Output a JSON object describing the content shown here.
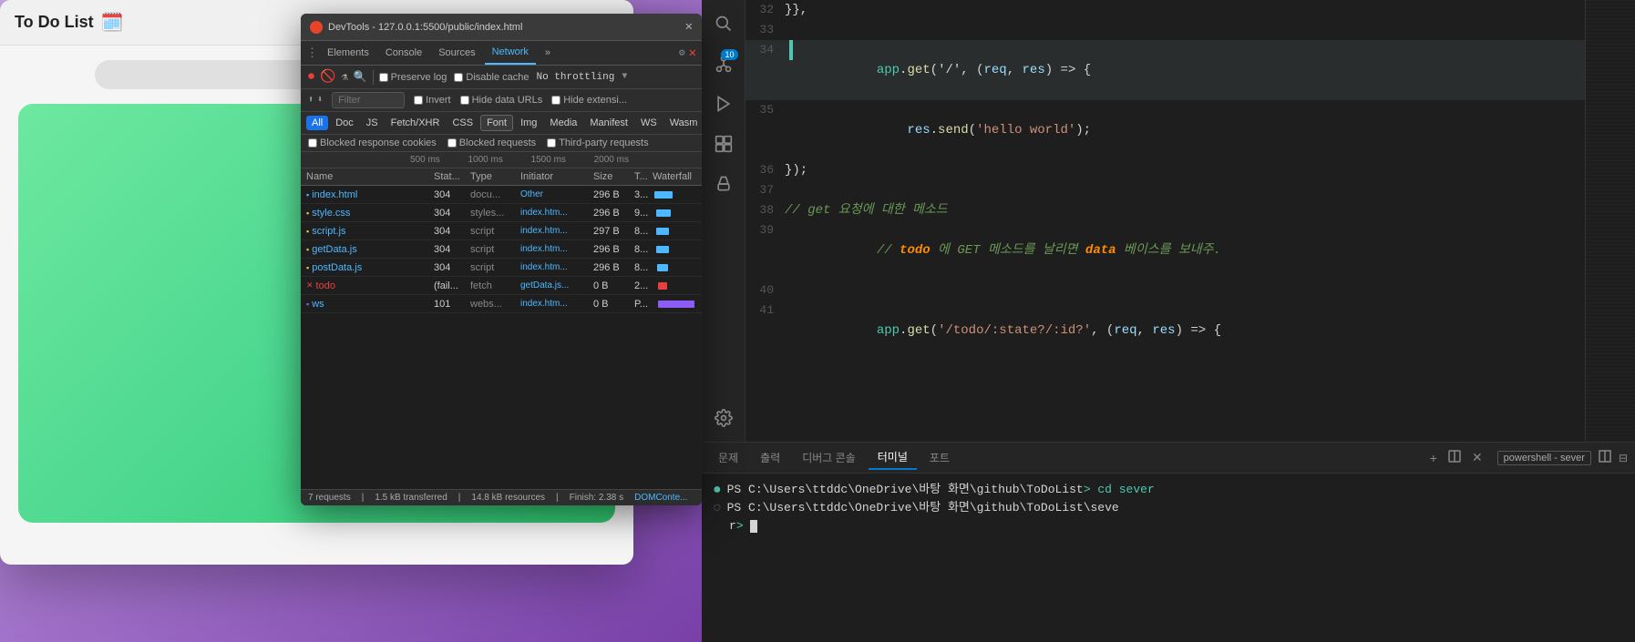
{
  "todo_app": {
    "title": "To Do List",
    "icon": "🗓️"
  },
  "devtools": {
    "title": "DevTools - 127.0.0.1:5500/public/index.html",
    "tabs": [
      "Elements",
      "Console",
      "Sources",
      "Network",
      "»"
    ],
    "active_tab": "Network",
    "toolbar": {
      "preserve_log": "Preserve log",
      "disable_cache": "Disable cache",
      "throttle": "No throttling"
    },
    "filter_placeholder": "Filter",
    "filter_options": [
      "Invert",
      "Hide data URLs",
      "Hide extensi..."
    ],
    "type_buttons": [
      "All",
      "Doc",
      "JS",
      "Fetch/XHR",
      "CSS",
      "Font",
      "Img",
      "Media",
      "Manifest",
      "WS",
      "Wasm"
    ],
    "active_type": "All",
    "highlighted_type": "Font",
    "blocked_options": [
      "Blocked response cookies",
      "Blocked requests",
      "Third-party requests"
    ],
    "timeline_labels": [
      "500 ms",
      "1000 ms",
      "1500 ms",
      "2000 ms"
    ],
    "table_headers": [
      "Name",
      "Stat...",
      "Type",
      "Initiator",
      "Size",
      "T...",
      "Waterfall"
    ],
    "requests": [
      {
        "name": "index.html",
        "status": "304",
        "type": "docu...",
        "initiator": "Other",
        "size": "296 B",
        "time": "3...",
        "icon": "doc"
      },
      {
        "name": "style.css",
        "status": "304",
        "type": "styles...",
        "initiator": "index.htm...",
        "size": "296 B",
        "time": "9...",
        "icon": "css"
      },
      {
        "name": "script.js",
        "status": "304",
        "type": "script",
        "initiator": "index.htm...",
        "size": "297 B",
        "time": "8...",
        "icon": "js"
      },
      {
        "name": "getData.js",
        "status": "304",
        "type": "script",
        "initiator": "index.htm...",
        "size": "296 B",
        "time": "8...",
        "icon": "js"
      },
      {
        "name": "postData.js",
        "status": "304",
        "type": "script",
        "initiator": "index.htm...",
        "size": "296 B",
        "time": "8...",
        "icon": "js"
      },
      {
        "name": "todo",
        "status": "(fail...",
        "type": "fetch",
        "initiator": "getData.js...",
        "size": "0 B",
        "time": "2...",
        "icon": "error"
      },
      {
        "name": "ws",
        "status": "101",
        "type": "webs...",
        "initiator": "index.htm...",
        "size": "0 B",
        "time": "P...",
        "icon": "ws"
      }
    ],
    "statusbar": {
      "requests": "7 requests",
      "transferred": "1.5 kB transferred",
      "resources": "14.8 kB resources",
      "finish": "Finish: 2.38 s",
      "domcontent": "DOMConte..."
    }
  },
  "vscode": {
    "activity_icons": [
      "files",
      "search",
      "source-control",
      "debug",
      "extensions",
      "test",
      "settings"
    ],
    "badge_value": "10",
    "code_lines": [
      {
        "num": "32",
        "content": "}},"
      },
      {
        "num": "33",
        "content": ""
      },
      {
        "num": "34",
        "content": "app.get('/', (req, res) => {",
        "tokens": [
          {
            "text": "app",
            "class": "c-green"
          },
          {
            "text": ".",
            "class": "c-white"
          },
          {
            "text": "get",
            "class": "c-yellow"
          },
          {
            "text": "('/', ",
            "class": "c-white"
          },
          {
            "text": "(req, res)",
            "class": "c-blue"
          },
          {
            "text": " => {",
            "class": "c-white"
          }
        ]
      },
      {
        "num": "35",
        "content": "    res.send('hello world');",
        "tokens": [
          {
            "text": "    ",
            "class": "c-white"
          },
          {
            "text": "res",
            "class": "c-blue"
          },
          {
            "text": ".",
            "class": "c-white"
          },
          {
            "text": "send",
            "class": "c-yellow"
          },
          {
            "text": "('hello world');",
            "class": "c-orange"
          }
        ]
      },
      {
        "num": "36",
        "content": "});"
      },
      {
        "num": "37",
        "content": ""
      },
      {
        "num": "38",
        "content": "// get 요청에 대한 메소드",
        "class": "c-comment"
      },
      {
        "num": "39",
        "content": "// todo 에 GET 메소드를 날리면 data 베이스를 보내주.",
        "class": "c-comment"
      },
      {
        "num": "40",
        "content": ""
      },
      {
        "num": "41",
        "content": "app.get('/todo/:state?/:id?', (req, res) => {"
      }
    ],
    "terminal": {
      "tabs": [
        "문제",
        "출력",
        "디버그 콘솔",
        "터미널",
        "포트"
      ],
      "active_tab": "터미널",
      "add_icon": "+",
      "split_icon": "⊞",
      "close_icon": "✕",
      "terminal_name": "powershell - sever",
      "lines": [
        {
          "dot": "●",
          "dot_color": "green",
          "text": "PS C:\\Users\\ttddc\\OneDrive\\바탕 화면\\github\\ToDoList> cd sever"
        },
        {
          "dot": "○",
          "dot_color": "empty",
          "text": "PS C:\\Users\\ttddc\\OneDrive\\바탕 화면\\github\\ToDoList\\sever",
          "next": ">"
        },
        {
          "cursor": true
        }
      ]
    }
  }
}
